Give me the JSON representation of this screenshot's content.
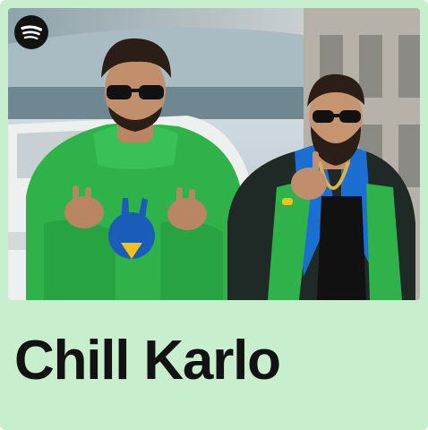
{
  "playlist": {
    "title": "Chill Karlo",
    "logo_icon": "spotify-logo-icon",
    "cover_art": "two-artists-photo"
  },
  "colors": {
    "card_background": "#c7efcd",
    "title_text": "#121212",
    "logo_fill": "#121212",
    "logo_glyph": "#ffffff",
    "hoodie_green": "#2fb24a"
  }
}
